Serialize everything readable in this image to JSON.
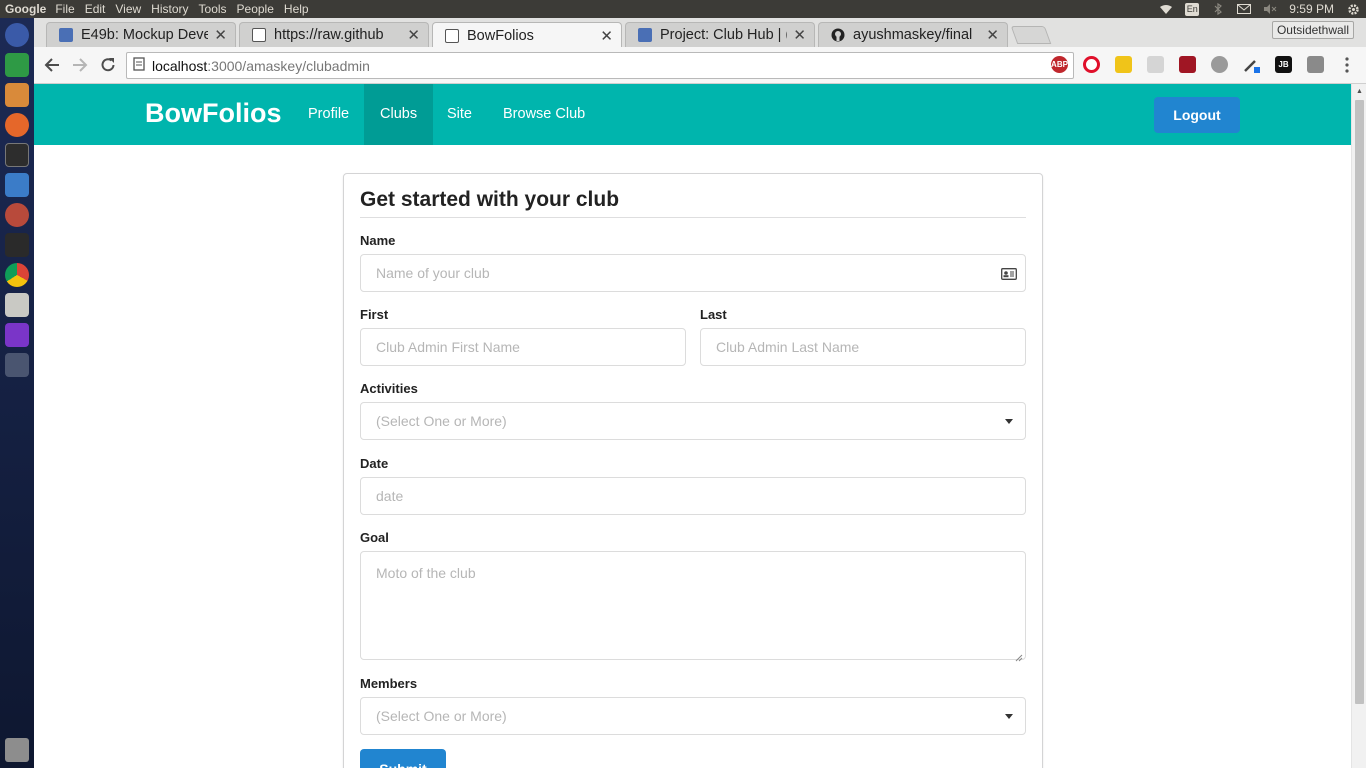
{
  "os": {
    "app_name": "Google",
    "menu": [
      "File",
      "Edit",
      "View",
      "History",
      "Tools",
      "People",
      "Help"
    ],
    "keyboard_layout": "En",
    "clock": "9:59 PM"
  },
  "browser": {
    "profile_name": "Outsidethwall",
    "tabs": [
      {
        "title": "E49b: Mockup Deve",
        "icon": "document-icon",
        "active": false
      },
      {
        "title": "https://raw.github",
        "icon": "page-icon",
        "active": false
      },
      {
        "title": "BowFolios",
        "icon": "page-icon",
        "active": true
      },
      {
        "title": "Project: Club Hub | (",
        "icon": "document-icon",
        "active": false
      },
      {
        "title": "ayushmaskey/final",
        "icon": "github-icon",
        "active": false
      }
    ],
    "url_host": "localhost",
    "url_path": ":3000/amaskey/clubadmin",
    "extensions": [
      "ABP",
      "opera-icon",
      "notes-icon",
      "rss-icon",
      "ublock-icon",
      "palette-icon",
      "eyedropper-icon",
      "JB",
      "sync-icon"
    ]
  },
  "navbar": {
    "brand": "BowFolios",
    "links": [
      "Profile",
      "Clubs",
      "Site",
      "Browse Club"
    ],
    "active_link": "Clubs",
    "logout_label": "Logout",
    "color": "#00b5ad"
  },
  "form": {
    "title": "Get started with your club",
    "name_label": "Name",
    "name_placeholder": "Name of your club",
    "first_label": "First",
    "first_placeholder": "Club Admin First Name",
    "last_label": "Last",
    "last_placeholder": "Club Admin Last Name",
    "activities_label": "Activities",
    "activities_placeholder": "(Select One or More)",
    "date_label": "Date",
    "date_placeholder": "date",
    "goal_label": "Goal",
    "goal_placeholder": "Moto of the club",
    "members_label": "Members",
    "members_placeholder": "(Select One or More)",
    "submit_label": "Submit",
    "button_color": "#2185d0"
  }
}
